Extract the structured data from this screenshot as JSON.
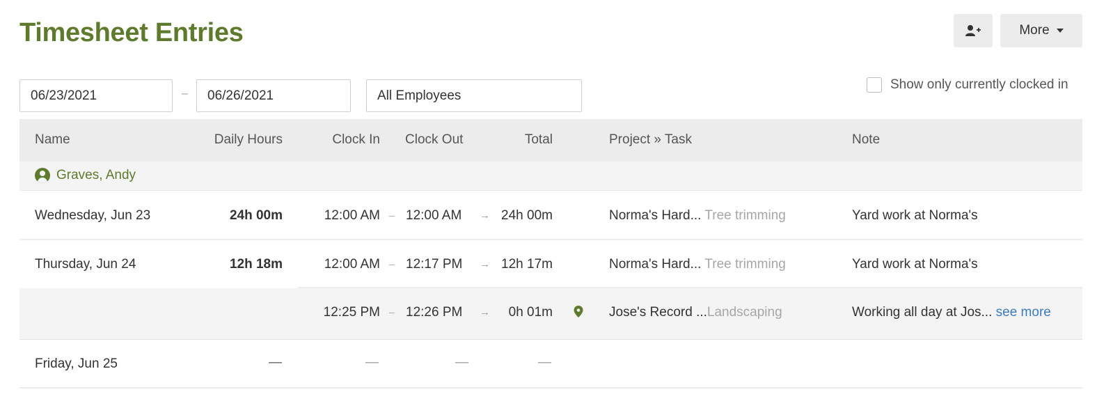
{
  "header": {
    "title": "Timesheet Entries",
    "add_user_icon": "user-plus-icon",
    "more_label": "More"
  },
  "filters": {
    "start_date": "06/23/2021",
    "date_separator": "–",
    "end_date": "06/26/2021",
    "employees": "All Employees",
    "clocked_in_label": "Show only currently clocked in",
    "clocked_in_checked": false
  },
  "table": {
    "columns": {
      "name": "Name",
      "daily_hours": "Daily Hours",
      "clock_in": "Clock In",
      "clock_out": "Clock Out",
      "total": "Total",
      "project_task": "Project » Task",
      "note": "Note"
    },
    "group": {
      "employee": "Graves, Andy",
      "icon": "user-circle-icon"
    },
    "rows": [
      {
        "day": "Wednesday, Jun 23",
        "daily_hours": "24h 00m",
        "clock_in": "12:00 AM",
        "clock_out": "12:00 AM",
        "total": "24h 00m",
        "project": "Norma's Hard...",
        "task": "Tree trimming",
        "note": "Yard work at Norma's"
      },
      {
        "day": "Thursday, Jun 24",
        "daily_hours": "12h 18m",
        "clock_in": "12:00 AM",
        "clock_out": "12:17 PM",
        "total": "12h 17m",
        "project": "Norma's Hard...",
        "task": "Tree trimming",
        "note": "Yard work at Norma's"
      },
      {
        "day": "",
        "daily_hours": "",
        "clock_in": "12:25 PM",
        "clock_out": "12:26 PM",
        "total": "0h 01m",
        "location_icon": "map-pin-icon",
        "project": "Jose's Record ...",
        "task": "Landscaping",
        "note": "Working all day at Jos...",
        "see_more": "see more"
      },
      {
        "day": "Friday, Jun 25",
        "daily_hours": "—",
        "clock_in": "—",
        "clock_out": "—",
        "total": "—"
      }
    ],
    "range_separator": "–",
    "arrow": "→"
  },
  "colors": {
    "brand_green": "#5e7a2c",
    "link_blue": "#3b7bbf",
    "header_bg": "#ececec",
    "muted_text": "#a6a6a6"
  }
}
